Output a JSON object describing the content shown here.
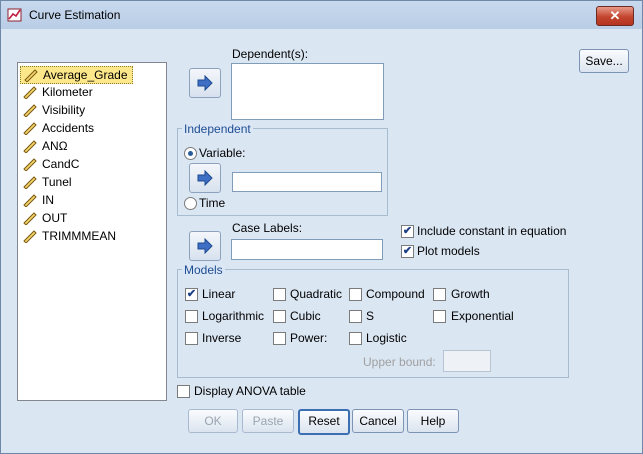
{
  "window": {
    "title": "Curve Estimation",
    "close_label": "✕"
  },
  "variables": [
    "Average_Grade",
    "Kilometer",
    "Visibility",
    "Accidents",
    "ANΩ",
    "CandC",
    "Tunel",
    "IN",
    "OUT",
    "TRIMMMEAN"
  ],
  "dependent": {
    "label": "Dependent(s):",
    "value": ""
  },
  "independent": {
    "title": "Independent",
    "variable_label": "Variable:",
    "variable_value": "",
    "time_label": "Time",
    "selected": "Variable"
  },
  "case_labels": {
    "label": "Case Labels:",
    "value": ""
  },
  "options": {
    "include_constant": {
      "label": "Include constant in equation",
      "checked": true
    },
    "plot_models": {
      "label": "Plot models",
      "checked": true
    },
    "display_anova": {
      "label": "Display ANOVA table",
      "checked": false
    }
  },
  "models": {
    "title": "Models",
    "items": [
      {
        "label": "Linear",
        "checked": true
      },
      {
        "label": "Quadratic",
        "checked": false
      },
      {
        "label": "Compound",
        "checked": false
      },
      {
        "label": "Growth",
        "checked": false
      },
      {
        "label": "Logarithmic",
        "checked": false
      },
      {
        "label": "Cubic",
        "checked": false
      },
      {
        "label": "S",
        "checked": false
      },
      {
        "label": "Exponential",
        "checked": false
      },
      {
        "label": "Inverse",
        "checked": false
      },
      {
        "label": "Power:",
        "checked": false
      },
      {
        "label": "Logistic",
        "checked": false
      }
    ],
    "upper_bound_label": "Upper bound:",
    "upper_bound_value": ""
  },
  "buttons": {
    "save": "Save...",
    "ok": "OK",
    "paste": "Paste",
    "reset": "Reset",
    "cancel": "Cancel",
    "help": "Help"
  },
  "check_mark": "✔"
}
